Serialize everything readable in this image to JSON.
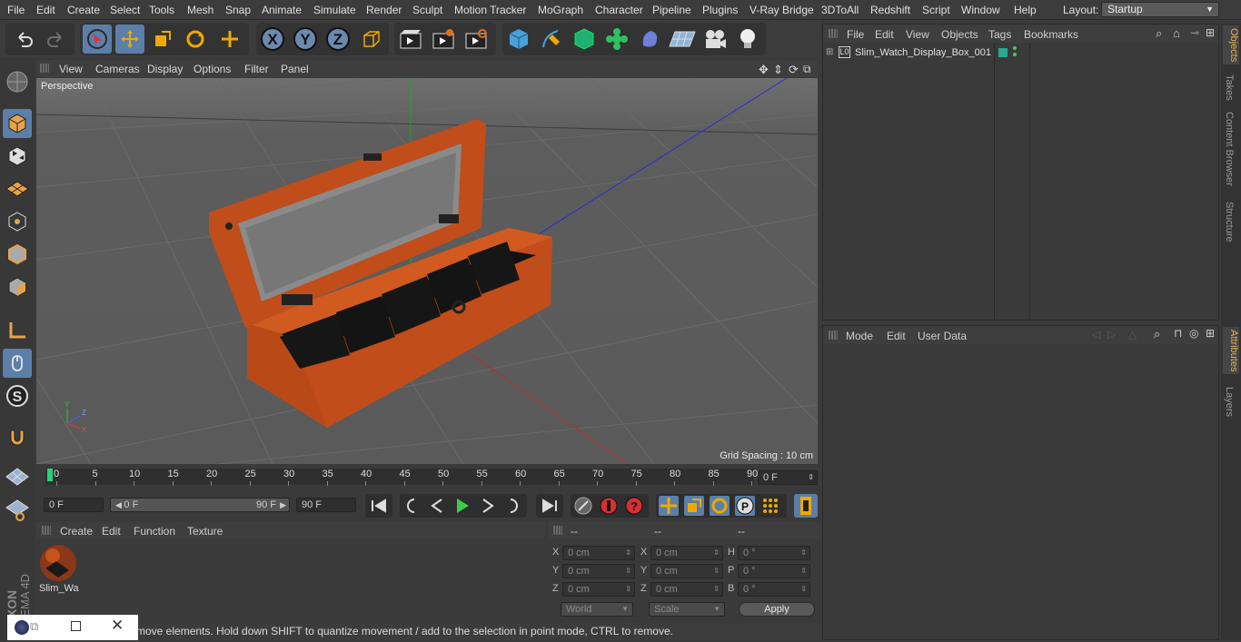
{
  "menu": [
    "File",
    "Edit",
    "Create",
    "Select",
    "Tools",
    "Mesh",
    "Snap",
    "Animate",
    "Simulate",
    "Render",
    "Sculpt",
    "Motion Tracker",
    "MoGraph",
    "Character",
    "Pipeline",
    "Plugins",
    "V-Ray Bridge",
    "3DToAll",
    "Redshift",
    "Script",
    "Window",
    "Help"
  ],
  "layout": {
    "label": "Layout:",
    "value": "Startup"
  },
  "toolbar": {
    "undo": "undo-icon",
    "redo": "redo-icon",
    "axis_x": "X",
    "axis_y": "Y",
    "axis_z": "Z"
  },
  "viewport": {
    "menu": [
      "View",
      "Cameras",
      "Display",
      "Options",
      "Filter",
      "Panel"
    ],
    "label": "Perspective",
    "grid_spacing": "Grid Spacing : 10 cm"
  },
  "timeline": {
    "ticks": [
      "0",
      "5",
      "10",
      "15",
      "20",
      "25",
      "30",
      "35",
      "40",
      "45",
      "50",
      "55",
      "60",
      "65",
      "70",
      "75",
      "80",
      "85",
      "90"
    ],
    "current": "0 F"
  },
  "transport": {
    "start": "0 F",
    "range_start": "0 F",
    "range_end": "90 F",
    "end": "90 F"
  },
  "material": {
    "menu": [
      "Create",
      "Edit",
      "Function",
      "Texture"
    ],
    "items": [
      {
        "name": "Slim_Wa"
      }
    ]
  },
  "coords": {
    "headers": [
      "--",
      "--",
      "--"
    ],
    "rows": [
      {
        "a": "X",
        "av": "0 cm",
        "b": "X",
        "bv": "0 cm",
        "c": "H",
        "cv": "0 °"
      },
      {
        "a": "Y",
        "av": "0 cm",
        "b": "Y",
        "bv": "0 cm",
        "c": "P",
        "cv": "0 °"
      },
      {
        "a": "Z",
        "av": "0 cm",
        "b": "Z",
        "bv": "0 cm",
        "c": "B",
        "cv": "0 °"
      }
    ],
    "mode": "World",
    "scale": "Scale",
    "apply": "Apply"
  },
  "status": "move elements. Hold down SHIFT to quantize movement / add to the selection in point mode, CTRL to remove.",
  "objects": {
    "menu": [
      "File",
      "Edit",
      "View",
      "Objects",
      "Tags",
      "Bookmarks"
    ],
    "items": [
      {
        "name": "Slim_Watch_Display_Box_001"
      }
    ]
  },
  "attributes": {
    "menu": [
      "Mode",
      "Edit",
      "User Data"
    ]
  },
  "side_tabs": [
    "Objects",
    "Takes",
    "Content Browser",
    "Structure"
  ],
  "side_tabs2": [
    "Attributes",
    "Layers"
  ],
  "brand": "MAXON CINEMA 4D",
  "colors": {
    "accent": "#5b7fa8",
    "active_tab": "#e8b34b",
    "box": "#c4541c"
  }
}
